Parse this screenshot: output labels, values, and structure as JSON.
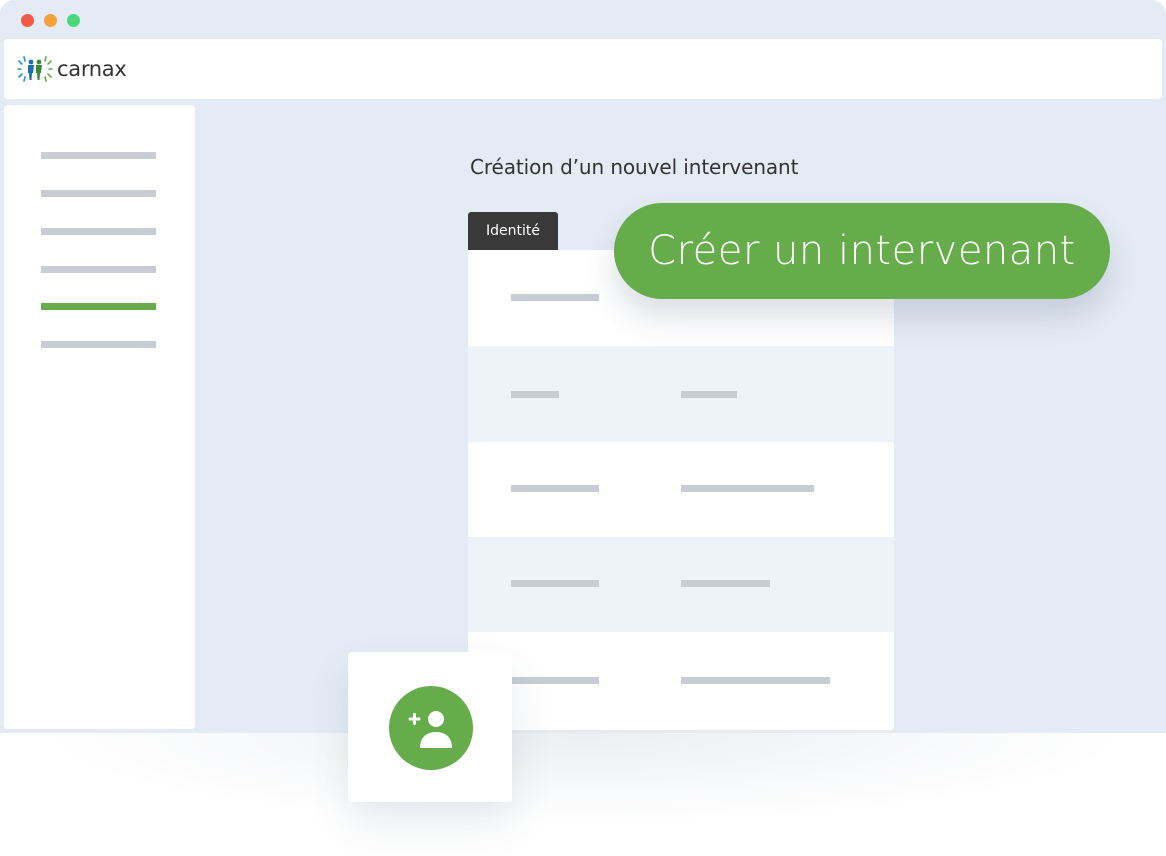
{
  "window": {
    "controls": [
      {
        "name": "close",
        "color": "#f25a45"
      },
      {
        "name": "minimize",
        "color": "#f6a03a"
      },
      {
        "name": "maximize",
        "color": "#4cd77a"
      }
    ]
  },
  "header": {
    "logo_text": "carnax"
  },
  "sidebar": {
    "items": [
      {
        "state": "default"
      },
      {
        "state": "default"
      },
      {
        "state": "default"
      },
      {
        "state": "default"
      },
      {
        "state": "active"
      },
      {
        "state": "default"
      }
    ],
    "active_color": "#67ac4b"
  },
  "main": {
    "title": "Création d’un nouvel intervenant",
    "tab_label": "Identité"
  },
  "cta": {
    "label": "Créer un intervenant",
    "color": "#67ac4b"
  },
  "fab": {
    "icon": "add-user-icon",
    "color": "#67ac4b"
  }
}
